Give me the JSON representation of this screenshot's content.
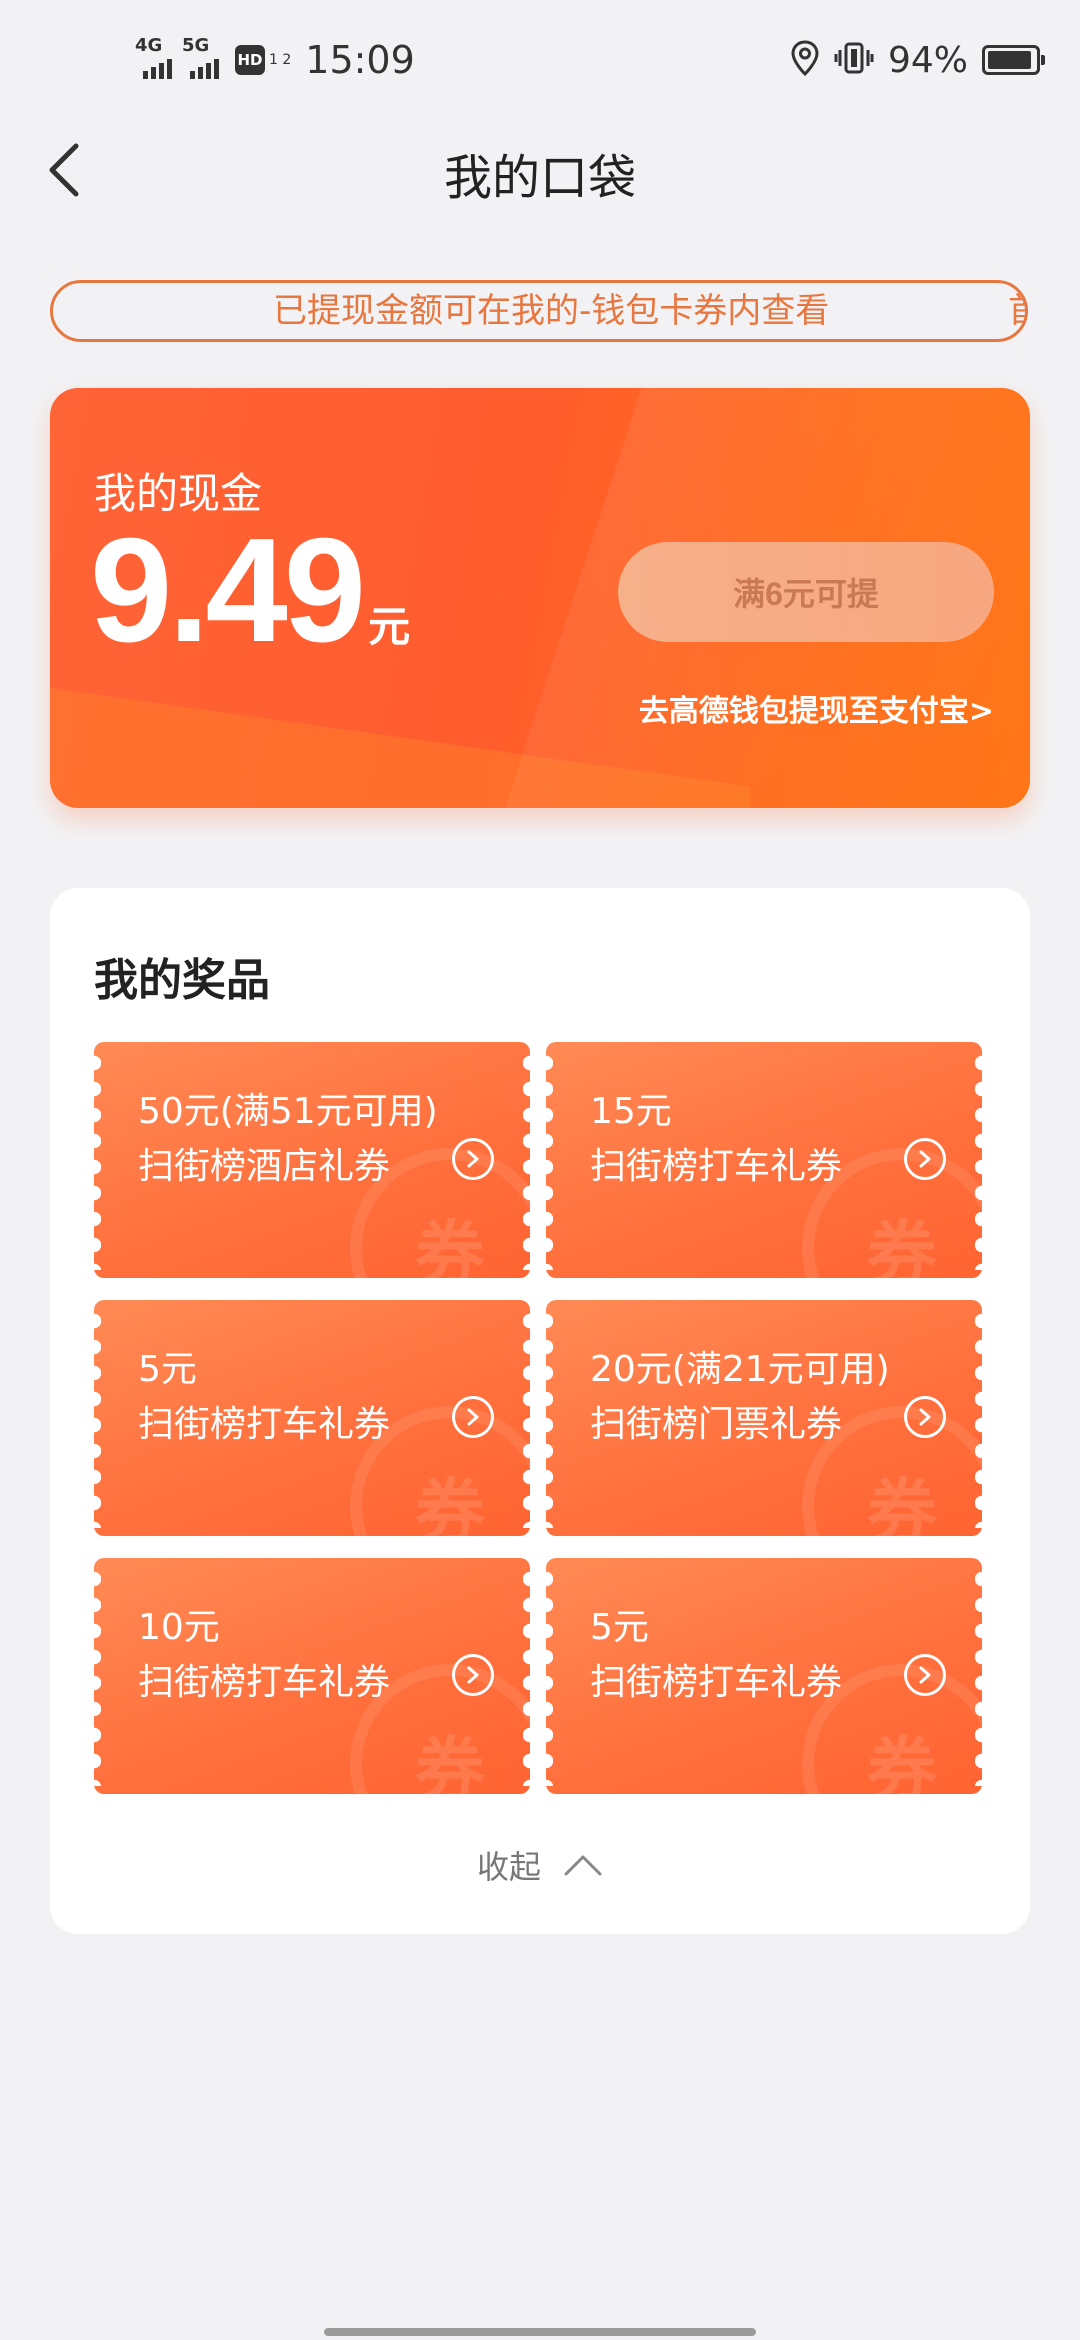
{
  "status_bar": {
    "network_1": "4G",
    "network_2": "5G",
    "hd": "HD",
    "hd_sub": "1 2",
    "time": "15:09",
    "battery": "94%",
    "battery_level": 0.94
  },
  "header": {
    "title": "我的口袋"
  },
  "notice": {
    "text": "已提现金额可在我的-钱包卡券内查看",
    "text_next": "首"
  },
  "cash": {
    "label": "我的现金",
    "amount": "9.49",
    "unit": "元",
    "withdraw_button": "满6元可提",
    "alipay_link": "去高德钱包提现至支付宝>"
  },
  "prizes": {
    "title": "我的奖品",
    "coupon_watermark": "券",
    "items": [
      {
        "amount": "50元(满51元可用)",
        "name": "扫街榜酒店礼券"
      },
      {
        "amount": "15元",
        "name": "扫街榜打车礼券"
      },
      {
        "amount": "5元",
        "name": "扫街榜打车礼券"
      },
      {
        "amount": "20元(满21元可用)",
        "name": "扫街榜门票礼券"
      },
      {
        "amount": "10元",
        "name": "扫街榜打车礼券"
      },
      {
        "amount": "5元",
        "name": "扫街榜打车礼券"
      }
    ],
    "collapse_label": "收起"
  },
  "colors": {
    "accent": "#ff6a2a",
    "notice_border": "#e8763f"
  }
}
